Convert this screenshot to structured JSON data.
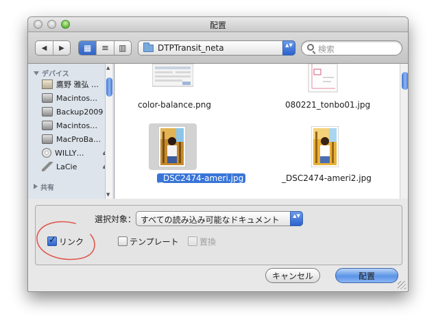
{
  "window": {
    "title": "配置"
  },
  "toolbar": {
    "back_glyph": "◀",
    "forward_glyph": "▶",
    "view_glyphs": [
      "▦",
      "≡",
      "▥"
    ],
    "location": "DTPTransit_neta",
    "stepper_glyph": "▲▼",
    "search_placeholder": "検索"
  },
  "sidebar": {
    "devices_header": "デバイス",
    "shared_header": "共有",
    "items": [
      {
        "label": "鷹野 雅弘 …",
        "icon": "home-icon",
        "eject": ""
      },
      {
        "label": "Macintos…",
        "icon": "hard-drive-icon",
        "eject": ""
      },
      {
        "label": "Backup2009",
        "icon": "hard-drive-icon",
        "eject": ""
      },
      {
        "label": "Macintos…",
        "icon": "hard-drive-icon",
        "eject": ""
      },
      {
        "label": "MacProBa…",
        "icon": "hard-drive-icon",
        "eject": ""
      },
      {
        "label": "WILLY…",
        "icon": "disc-icon",
        "eject": "⏏"
      },
      {
        "label": "LaCie",
        "icon": "network-drive-icon",
        "eject": "⏏"
      }
    ]
  },
  "files": [
    {
      "name": "color-balance.png",
      "selected": false
    },
    {
      "name": "080221_tonbo01.jpg",
      "selected": false
    },
    {
      "name": "_DSC2474-ameri.jpg",
      "selected": true
    },
    {
      "name": "_DSC2474-ameri2.jpg",
      "selected": false
    }
  ],
  "options": {
    "filter_label": "選択対象：",
    "filter_value": "すべての読み込み可能なドキュメント",
    "link_label": "リンク",
    "link_checked": true,
    "template_label": "テンプレート",
    "template_checked": false,
    "replace_label": "置換",
    "replace_enabled": false
  },
  "buttons": {
    "cancel": "キャンセル",
    "place": "配置"
  },
  "colors": {
    "accent": "#3875d7",
    "annotation": "#e0564c",
    "sidebar_bg": "#dde4ec"
  }
}
